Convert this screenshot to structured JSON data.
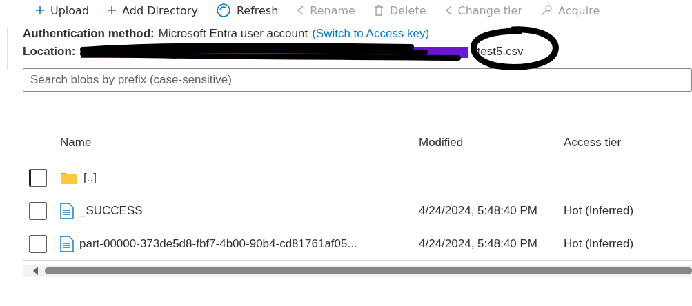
{
  "toolbar": [
    {
      "label": "Upload",
      "kind": "plus",
      "disabled": false
    },
    {
      "label": "Add Directory",
      "kind": "plus",
      "disabled": false
    },
    {
      "label": "Refresh",
      "kind": "refresh",
      "disabled": false
    },
    {
      "label": "Rename",
      "kind": "rename",
      "disabled": true
    },
    {
      "label": "Delete",
      "kind": "delete",
      "disabled": true
    },
    {
      "label": "Change tier",
      "kind": "tier",
      "disabled": true
    },
    {
      "label": "Acquire",
      "kind": "lease",
      "disabled": true
    }
  ],
  "auth": {
    "label": "Authentication method:",
    "value": "Microsoft Entra user account",
    "link": "(Switch to Access key)"
  },
  "location": {
    "label": "Location:",
    "file": "test5.csv"
  },
  "search": {
    "placeholder": "Search blobs by prefix (case-sensitive)"
  },
  "table": {
    "columns": [
      "Name",
      "Modified",
      "Access tier"
    ],
    "rows": [
      {
        "kind": "folder",
        "name": "[..]",
        "modified": "",
        "tier": "",
        "checked": false
      },
      {
        "kind": "file",
        "name": "_SUCCESS",
        "modified": "4/24/2024, 5:48:40 PM",
        "tier": "Hot (Inferred)",
        "checked": false
      },
      {
        "kind": "file",
        "name": "part-00000-373de5d8-fbf7-4b00-90b4-cd81761af05...",
        "modified": "4/24/2024, 5:48:40 PM",
        "tier": "Hot (Inferred)",
        "checked": false
      }
    ]
  }
}
